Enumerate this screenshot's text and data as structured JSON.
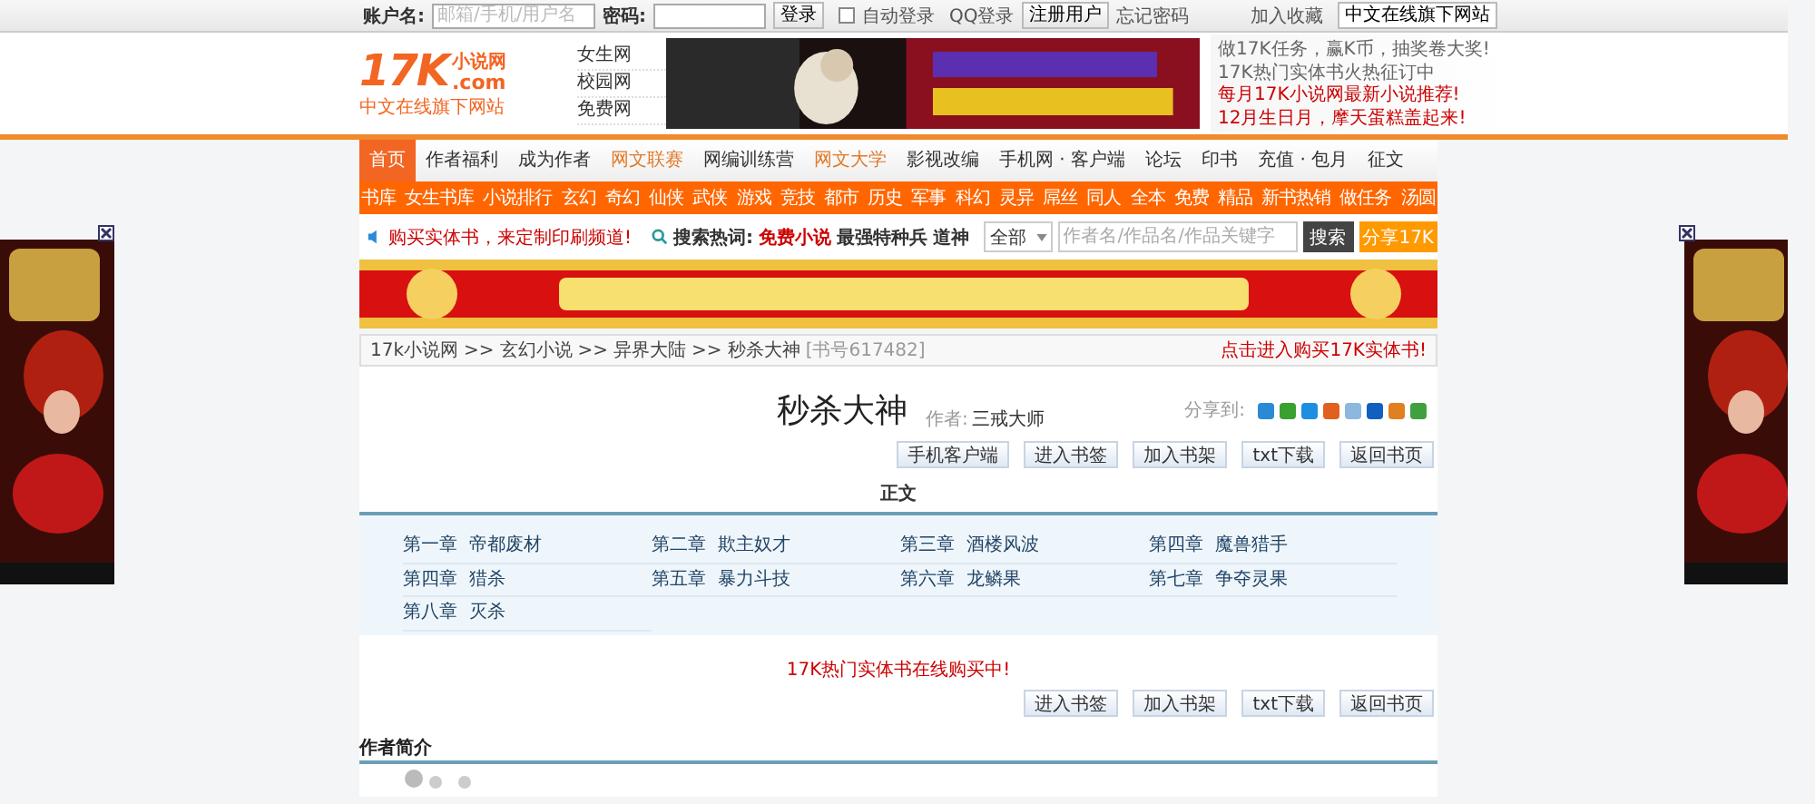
{
  "top_bar": {
    "account_label": "账户名:",
    "account_placeholder": "邮箱/手机/用户名",
    "password_label": "密码:",
    "login_button": "登录",
    "auto_login": {
      "label": "自动登录",
      "checked": false
    },
    "qq_login": "QQ登录",
    "register": "注册用户",
    "forgot": "忘记密码",
    "favorite": "加入收藏",
    "site_select": "中文在线旗下网站"
  },
  "logo": {
    "mark": "17K",
    "name": "小说网",
    "domain": ".com",
    "slogan": "中文在线旗下网站"
  },
  "sister_sites": [
    "女生网",
    "校园网",
    "免费网"
  ],
  "header_ad": {
    "kind": "picture"
  },
  "news": [
    {
      "text": "做17K任务，赢K币，抽奖卷大奖!",
      "hot": false
    },
    {
      "text": "17K热门实体书火热征订中",
      "hot": false
    },
    {
      "text": "每月17K小说网最新小说推荐!",
      "hot": true
    },
    {
      "text": "12月生日月，摩天蛋糕盖起来!",
      "hot": true
    }
  ],
  "nav": [
    {
      "label": "首页",
      "selected": true,
      "featured": false
    },
    {
      "label": "作者福利",
      "selected": false,
      "featured": false
    },
    {
      "label": "成为作者",
      "selected": false,
      "featured": false
    },
    {
      "label": "网文联赛",
      "selected": false,
      "featured": true
    },
    {
      "label": "网编训练营",
      "selected": false,
      "featured": false
    },
    {
      "label": "网文大学",
      "selected": false,
      "featured": true
    },
    {
      "label": "影视改编",
      "selected": false,
      "featured": false
    },
    {
      "label": "手机网 · 客户端",
      "selected": false,
      "featured": false
    },
    {
      "label": "论坛",
      "selected": false,
      "featured": false
    },
    {
      "label": "印书",
      "selected": false,
      "featured": false
    },
    {
      "label": "充值 · 包月",
      "selected": false,
      "featured": false
    },
    {
      "label": "征文",
      "selected": false,
      "featured": false
    }
  ],
  "sub_nav": [
    "书库",
    "女生书库",
    "小说排行",
    "玄幻",
    "奇幻",
    "仙侠",
    "武侠",
    "游戏",
    "竞技",
    "都市",
    "历史",
    "军事",
    "科幻",
    "灵异",
    "屌丝",
    "同人",
    "全本",
    "免费",
    "精品",
    "新书热销",
    "做任务",
    "汤圆"
  ],
  "promo": "购买实体书，来定制印刷频道!",
  "hot_search": {
    "label": "搜索热词:",
    "terms": [
      {
        "text": "免费小说",
        "hot": true
      },
      {
        "text": "最强特种兵",
        "hot": false
      },
      {
        "text": "道神",
        "hot": false
      }
    ]
  },
  "search": {
    "scope": "全部",
    "placeholder": "作者名/作品名/作品关键字",
    "button": "搜索"
  },
  "share_button": "分享17K",
  "banner": {
    "kind": "picture"
  },
  "breadcrumb": [
    {
      "text": "17k小说网",
      "kind": "link"
    },
    {
      "text": ">>",
      "kind": "separator"
    },
    {
      "text": "玄幻小说",
      "kind": "link"
    },
    {
      "text": ">>",
      "kind": "separator"
    },
    {
      "text": "异界大陆",
      "kind": "link"
    },
    {
      "text": ">>",
      "kind": "separator"
    },
    {
      "text": "秒杀大神",
      "kind": "link"
    },
    {
      "text": "[书号617482]",
      "kind": "note"
    }
  ],
  "buy_link": "点击进入购买17K实体书!",
  "book": {
    "title": "秒杀大神",
    "author_label": "作者:",
    "author": "三戒大师",
    "share_label": "分享到:"
  },
  "top_buttons": [
    "手机客户端",
    "进入书签",
    "加入书架",
    "txt下载",
    "返回书页"
  ],
  "section_title": "正文",
  "chapters": [
    {
      "number": "第一章",
      "title": "帝都废材"
    },
    {
      "number": "第二章",
      "title": "欺主奴才"
    },
    {
      "number": "第三章",
      "title": "酒楼风波"
    },
    {
      "number": "第四章",
      "title": "魔兽猎手"
    },
    {
      "number": "第四章",
      "title": "猎杀"
    },
    {
      "number": "第五章",
      "title": "暴力斗技"
    },
    {
      "number": "第六章",
      "title": "龙鳞果"
    },
    {
      "number": "第七章",
      "title": "争夺灵果"
    },
    {
      "number": "第八章",
      "title": "灭杀"
    }
  ],
  "promo_line": "17K热门实体书在线购买中!",
  "bottom_buttons": [
    "进入书签",
    "加入书架",
    "txt下载",
    "返回书页"
  ],
  "author_intro": {
    "title": "作者简介"
  },
  "side_ads": [
    {
      "kind": "picture"
    },
    {
      "kind": "picture"
    }
  ]
}
